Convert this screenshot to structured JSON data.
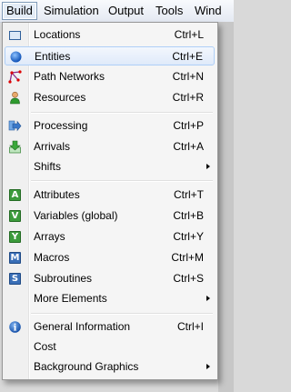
{
  "menubar": {
    "items": [
      {
        "label": "Build"
      },
      {
        "label": "Simulation"
      },
      {
        "label": "Output"
      },
      {
        "label": "Tools"
      },
      {
        "label": "Wind"
      }
    ]
  },
  "build_menu": {
    "items": [
      {
        "label": "Locations",
        "shortcut": "Ctrl+L",
        "icon": "locations-icon"
      },
      {
        "label": "Entities",
        "shortcut": "Ctrl+E",
        "icon": "entities-icon",
        "highlighted": true
      },
      {
        "label": "Path Networks",
        "shortcut": "Ctrl+N",
        "icon": "path-networks-icon"
      },
      {
        "label": "Resources",
        "shortcut": "Ctrl+R",
        "icon": "resources-icon"
      },
      {
        "label": "Processing",
        "shortcut": "Ctrl+P",
        "icon": "processing-icon"
      },
      {
        "label": "Arrivals",
        "shortcut": "Ctrl+A",
        "icon": "arrivals-icon"
      },
      {
        "label": "Shifts",
        "submenu": true
      },
      {
        "label": "Attributes",
        "shortcut": "Ctrl+T",
        "icon": "attributes-icon"
      },
      {
        "label": "Variables (global)",
        "shortcut": "Ctrl+B",
        "icon": "variables-icon"
      },
      {
        "label": "Arrays",
        "shortcut": "Ctrl+Y",
        "icon": "arrays-icon"
      },
      {
        "label": "Macros",
        "shortcut": "Ctrl+M",
        "icon": "macros-icon"
      },
      {
        "label": "Subroutines",
        "shortcut": "Ctrl+S",
        "icon": "subroutines-icon"
      },
      {
        "label": "More Elements",
        "submenu": true
      },
      {
        "label": "General Information",
        "shortcut": "Ctrl+I",
        "icon": "info-icon"
      },
      {
        "label": "Cost"
      },
      {
        "label": "Background Graphics",
        "submenu": true
      }
    ],
    "icon_letters": {
      "attributes": "A",
      "variables": "V",
      "arrays": "Y",
      "macros": "M",
      "subroutines": "S",
      "info": "i"
    }
  }
}
